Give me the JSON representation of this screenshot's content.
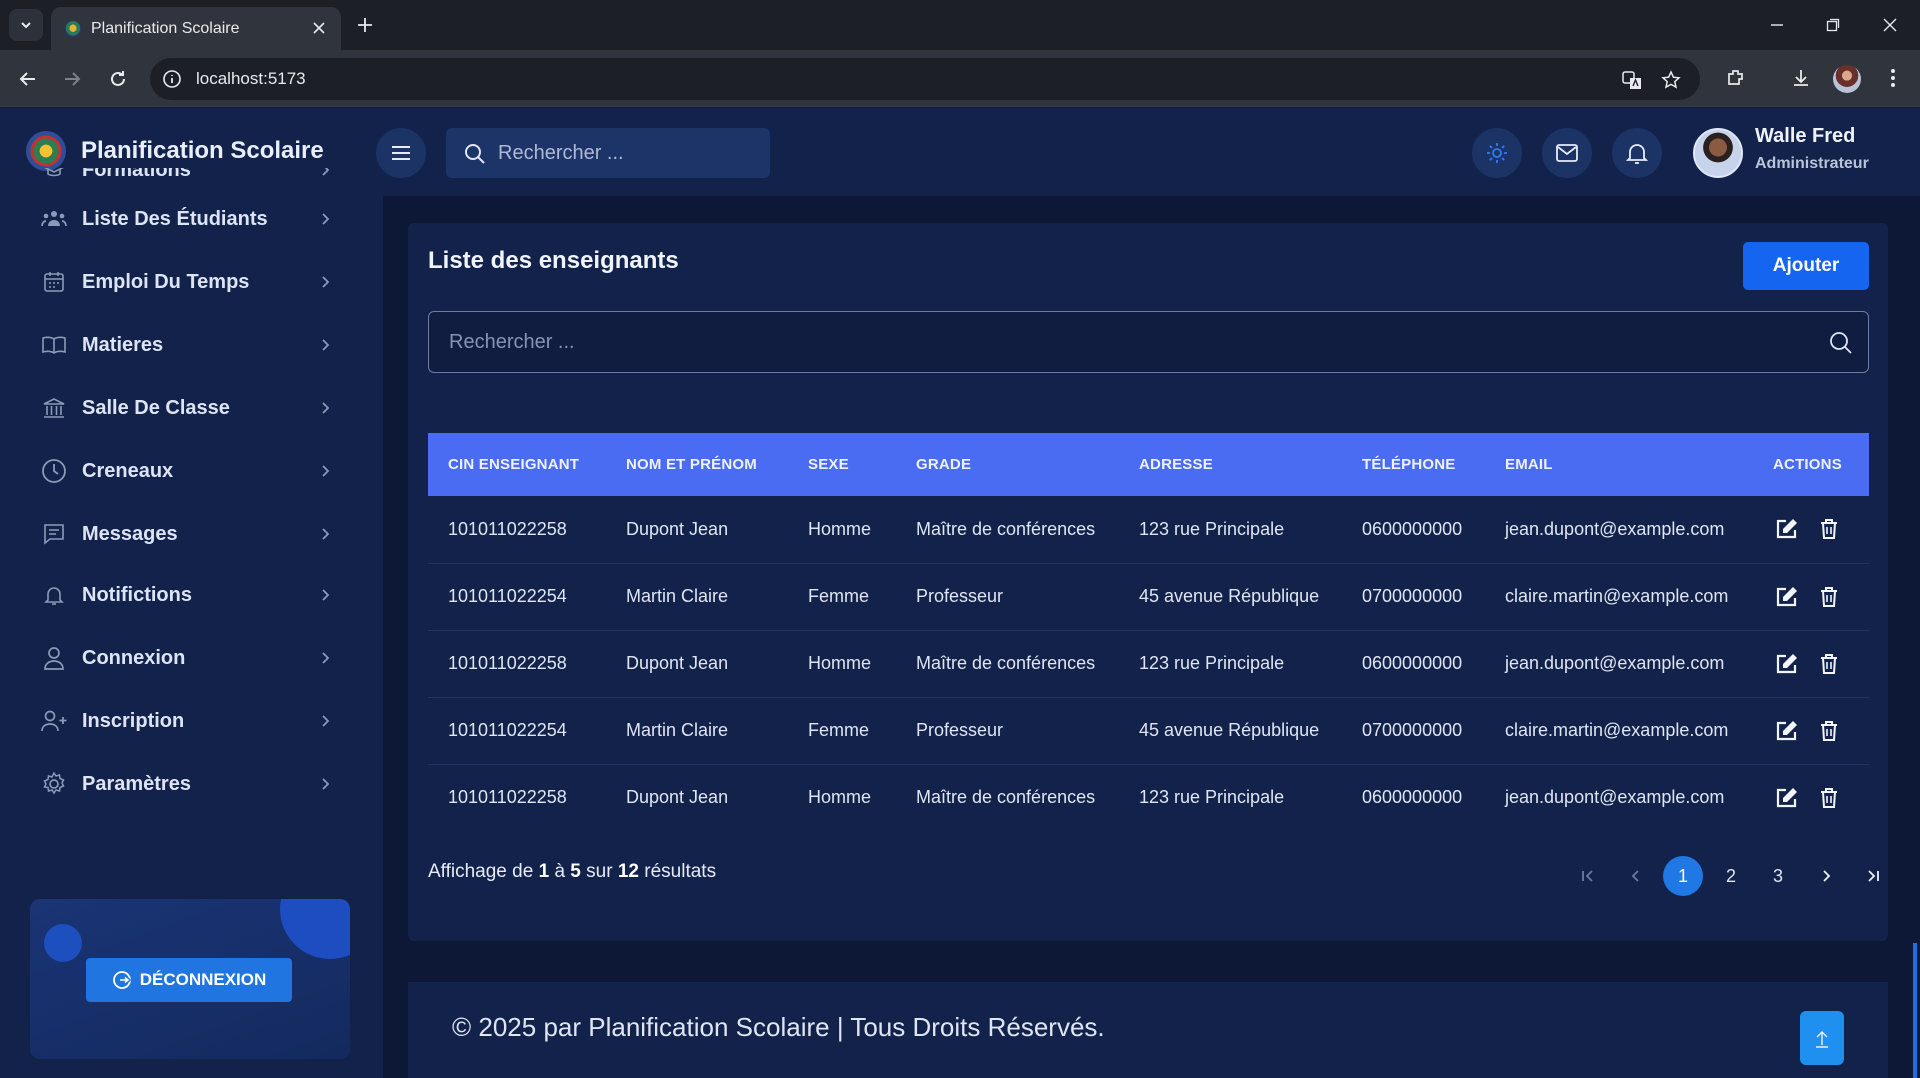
{
  "browser": {
    "tab_title": "Planification Scolaire",
    "url": "localhost:5173"
  },
  "app": {
    "brand": "Planification Scolaire",
    "search_placeholder": "Rechercher ...",
    "user": {
      "name": "Walle Fred",
      "role": "Administrateur"
    }
  },
  "sidebar": {
    "items": [
      {
        "label": "Formations",
        "icon": "graduation-icon"
      },
      {
        "label": "Liste Des Étudiants",
        "icon": "students-icon"
      },
      {
        "label": "Emploi Du Temps",
        "icon": "calendar-icon"
      },
      {
        "label": "Matieres",
        "icon": "book-icon"
      },
      {
        "label": "Salle De Classe",
        "icon": "building-icon"
      },
      {
        "label": "Creneaux",
        "icon": "clock-icon"
      },
      {
        "label": "Messages",
        "icon": "message-icon"
      },
      {
        "label": "Notifictions",
        "icon": "bell-icon"
      },
      {
        "label": "Connexion",
        "icon": "user-icon"
      },
      {
        "label": "Inscription",
        "icon": "user-plus-icon"
      },
      {
        "label": "Paramètres",
        "icon": "gear-icon"
      }
    ],
    "logout_label": "DÉCONNEXION"
  },
  "main": {
    "title": "Liste des enseignants",
    "add_label": "Ajouter",
    "search_placeholder": "Rechercher ...",
    "table": {
      "headers": [
        "CIN ENSEIGNANT",
        "NOM ET PRÉNOM",
        "SEXE",
        "GRADE",
        "ADRESSE",
        "TÉLÉPHONE",
        "EMAIL",
        "ACTIONS"
      ],
      "rows": [
        [
          "101011022258",
          "Dupont Jean",
          "Homme",
          "Maître de conférences",
          "123 rue Principale",
          "0600000000",
          "jean.dupont@example.com"
        ],
        [
          "101011022254",
          "Martin Claire",
          "Femme",
          "Professeur",
          "45 avenue République",
          "0700000000",
          "claire.martin@example.com"
        ],
        [
          "101011022258",
          "Dupont Jean",
          "Homme",
          "Maître de conférences",
          "123 rue Principale",
          "0600000000",
          "jean.dupont@example.com"
        ],
        [
          "101011022254",
          "Martin Claire",
          "Femme",
          "Professeur",
          "45 avenue République",
          "0700000000",
          "claire.martin@example.com"
        ],
        [
          "101011022258",
          "Dupont Jean",
          "Homme",
          "Maître de conférences",
          "123 rue Principale",
          "0600000000",
          "jean.dupont@example.com"
        ]
      ]
    },
    "summary": {
      "prefix": "Affichage de",
      "from": "1",
      "sep1": "à",
      "to": "5",
      "sep2": "sur",
      "total": "12",
      "suffix": "résultats"
    },
    "pagination": {
      "pages": [
        "1",
        "2",
        "3"
      ],
      "current": "1"
    }
  },
  "footer": {
    "text": "© 2025 par Planification Scolaire | Tous Droits Réservés."
  },
  "colors": {
    "accent": "#1565f0",
    "table_header": "#4a6cf2",
    "sidebar_bg": "#13224a",
    "page_bg": "#0c1836"
  }
}
